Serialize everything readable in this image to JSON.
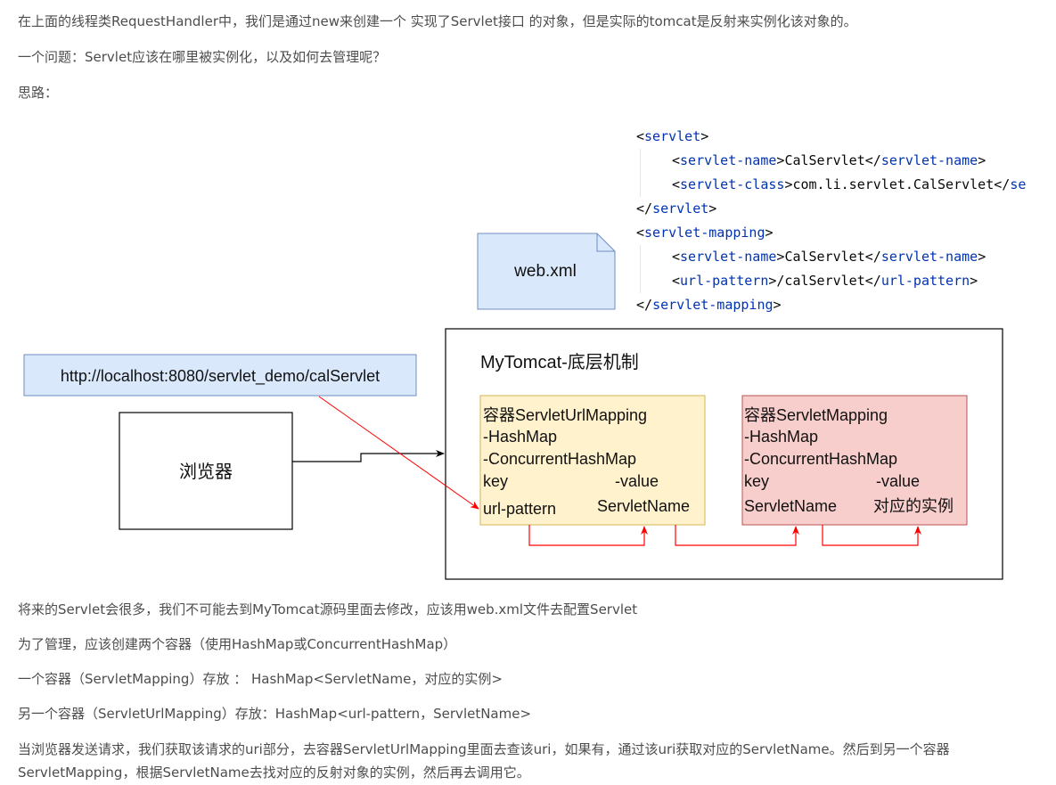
{
  "paragraphs": {
    "p1": "在上面的线程类RequestHandler中，我们是通过new来创建一个 实现了Servlet接口 的对象，但是实际的tomcat是反射来实例化该对象的。",
    "p2": "一个问题：Servlet应该在哪里被实例化，以及如何去管理呢？",
    "p3": "思路：",
    "p4": "将来的Servlet会很多，我们不可能去到MyTomcat源码里面去修改，应该用web.xml文件去配置Servlet",
    "p5": "为了管理，应该创建两个容器（使用HashMap或ConcurrentHashMap）",
    "p6": "一个容器（ServletMapping）存放 ： HashMap<ServletName，对应的实例>",
    "p7": "另一个容器（ServletUrlMapping）存放：HashMap<url-pattern，ServletName>",
    "p8": "当浏览器发送请求，我们获取该请求的uri部分，去容器ServletUrlMapping里面去查该uri，如果有，通过该uri获取对应的ServletName。然后到另一个容器ServletMapping，根据ServletName去找对应的反射对象的实例，然后再去调用它。"
  },
  "code": {
    "l1_tag": "servlet",
    "l2_tag": "servlet-name",
    "l2_val": "CalServlet",
    "l3_tag": "servlet-class",
    "l3_val": "com.li.servlet.CalServlet",
    "l3_close_partial": "se",
    "l4_tag": "servlet",
    "l5_tag": "servlet-mapping",
    "l6_tag": "servlet-name",
    "l6_val": "CalServlet",
    "l7_tag": "url-pattern",
    "l7_val": "/calServlet",
    "l8_tag": "servlet-mapping"
  },
  "diagram": {
    "webxml_label": "web.xml",
    "url_label": "http://localhost:8080/servlet_demo/calServlet",
    "browser_label": "浏览器",
    "tomcat_title": "MyTomcat-底层机制",
    "url_mapping": {
      "line1": "容器ServletUrlMapping",
      "line2": "-HashMap",
      "line3": "-ConcurrentHashMap",
      "key": "key",
      "value": "-value",
      "key_name": "url-pattern",
      "value_name": "ServletName"
    },
    "servlet_mapping": {
      "line1": "容器ServletMapping",
      "line2": "-HashMap",
      "line3": "-ConcurrentHashMap",
      "key": "key",
      "value": "-value",
      "key_name": "ServletName",
      "value_name": "对应的实例"
    },
    "colors": {
      "webxml_fill": "#dae8fc",
      "webxml_stroke": "#6c8ebf",
      "url_mapping_fill": "#fff2cc",
      "url_mapping_stroke": "#d6b656",
      "servlet_mapping_fill": "#f8cecc",
      "servlet_mapping_stroke": "#b85450",
      "arrow_red": "#ff0000"
    }
  }
}
